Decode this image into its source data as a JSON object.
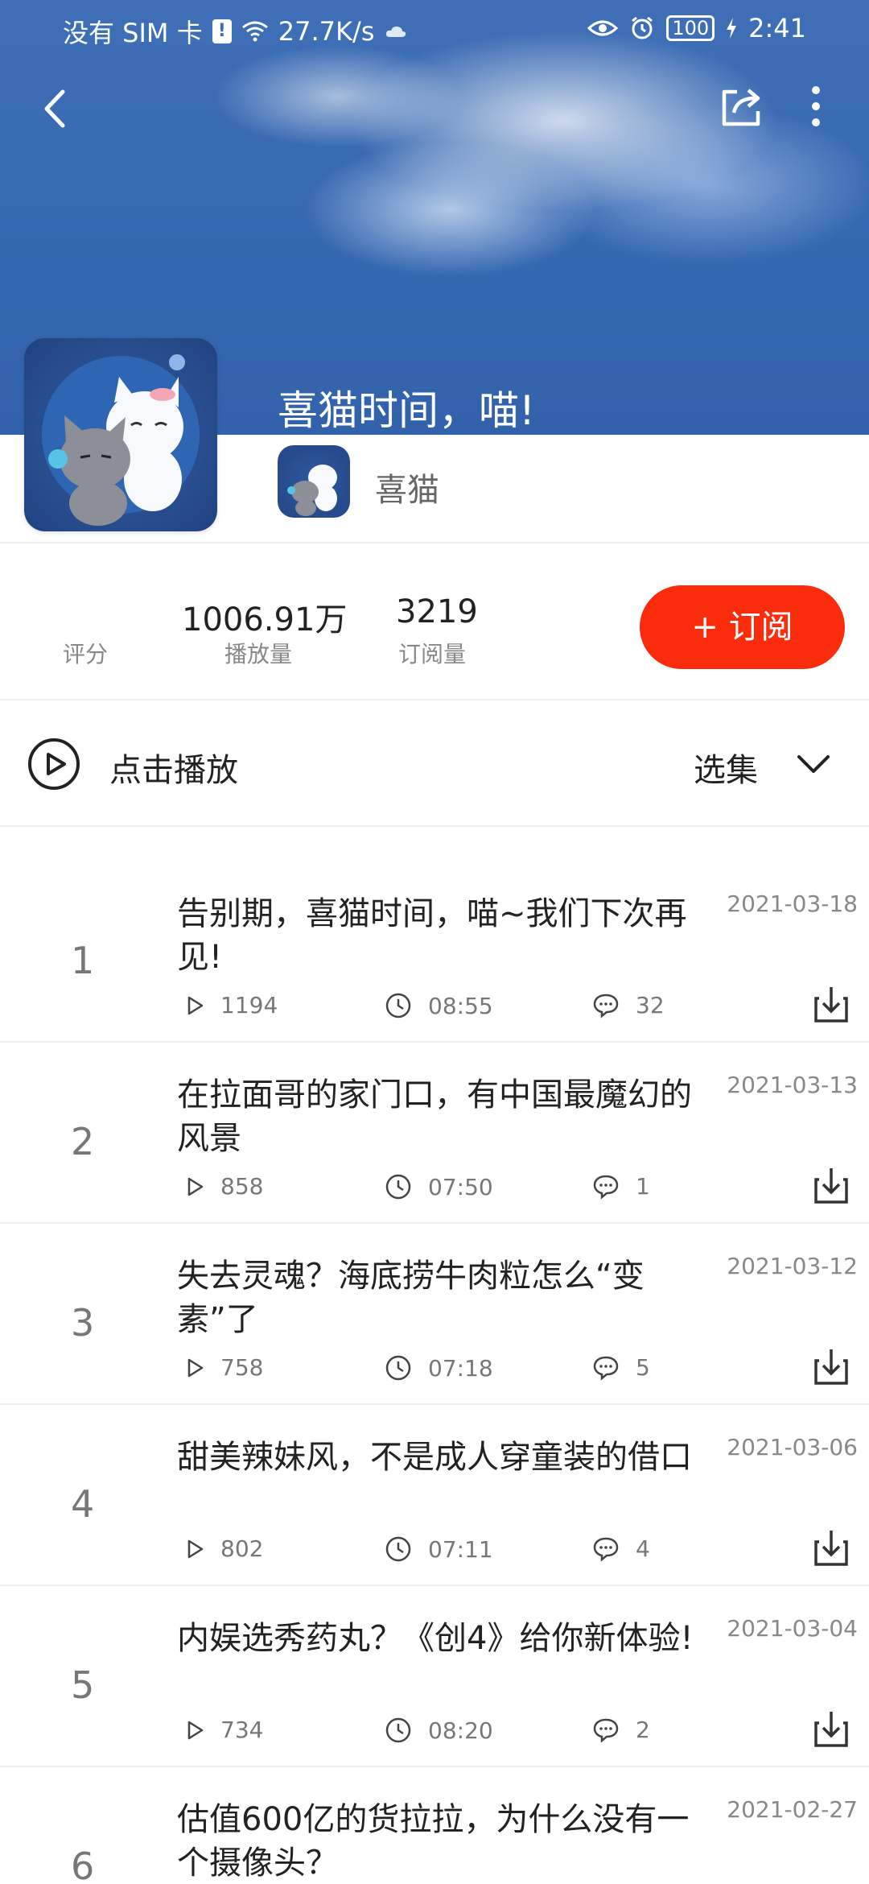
{
  "status_bar": {
    "carrier": "没有 SIM 卡",
    "sim_alert": "!",
    "speed": "27.7K/s",
    "battery": "100",
    "time": "2:41"
  },
  "album": {
    "title": "喜猫时间，喵!",
    "author": "喜猫"
  },
  "stats": {
    "rating_label": "评分",
    "plays_value": "1006.91万",
    "plays_label": "播放量",
    "subs_value": "3219",
    "subs_label": "订阅量",
    "subscribe_button": "+ 订阅"
  },
  "play_row": {
    "play_label": "点击播放",
    "select_label": "选集"
  },
  "episodes": [
    {
      "num": "1",
      "title": "告别期，喜猫时间，喵~我们下次再见!",
      "date": "2021-03-18",
      "plays": "1194",
      "duration": "08:55",
      "comments": "32"
    },
    {
      "num": "2",
      "title": "在拉面哥的家门口，有中国最魔幻的风景",
      "date": "2021-03-13",
      "plays": "858",
      "duration": "07:50",
      "comments": "1"
    },
    {
      "num": "3",
      "title": "失去灵魂？海底捞牛肉粒怎么“变素”了",
      "date": "2021-03-12",
      "plays": "758",
      "duration": "07:18",
      "comments": "5"
    },
    {
      "num": "4",
      "title": "甜美辣妹风，不是成人穿童装的借口",
      "date": "2021-03-06",
      "plays": "802",
      "duration": "07:11",
      "comments": "4"
    },
    {
      "num": "5",
      "title": "内娱选秀药丸？《创4》给你新体验!",
      "date": "2021-03-04",
      "plays": "734",
      "duration": "08:20",
      "comments": "2"
    },
    {
      "num": "6",
      "title": "估值600亿的货拉拉，为什么没有一个摄像头？",
      "date": "2021-02-27",
      "plays": "",
      "duration": "",
      "comments": ""
    }
  ],
  "colors": {
    "accent": "#fb2c0c",
    "header_blue": "#3568b0"
  }
}
